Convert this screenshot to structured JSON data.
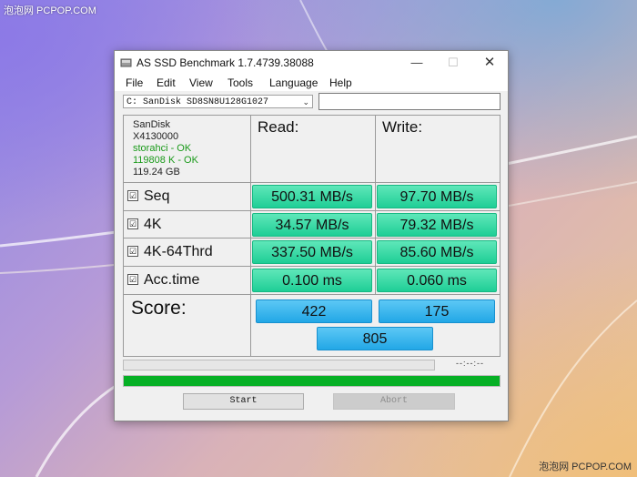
{
  "watermark": {
    "top_left": "泡泡网 PCPOP.COM",
    "bottom_right": "泡泡网 PCPOP.COM"
  },
  "window": {
    "title": "AS SSD Benchmark 1.7.4739.38088",
    "icon": "drive-icon",
    "controls": {
      "minimize": "—",
      "maximize": "☐",
      "close": "✕"
    }
  },
  "menu": [
    "File",
    "Edit",
    "View",
    "Tools",
    "Language",
    "Help"
  ],
  "drive": {
    "selected": "C: SanDisk SD8SN8U128G1027",
    "arrow": "⌄",
    "aux_value": ""
  },
  "device": {
    "name": "SanDisk",
    "firmware": "X4130000",
    "driver": "storahci - OK",
    "alignment": "119808 K - OK",
    "size": "119.24 GB"
  },
  "headers": {
    "read": "Read:",
    "write": "Write:"
  },
  "rows": [
    {
      "label": "Seq",
      "checked": "☑",
      "read": "500.31 MB/s",
      "write": "97.70 MB/s"
    },
    {
      "label": "4K",
      "checked": "☑",
      "read": "34.57 MB/s",
      "write": "79.32 MB/s"
    },
    {
      "label": "4K-64Thrd",
      "checked": "☑",
      "read": "337.50 MB/s",
      "write": "85.60 MB/s"
    },
    {
      "label": "Acc.time",
      "checked": "☑",
      "read": "0.100 ms",
      "write": "0.060 ms"
    }
  ],
  "score": {
    "label": "Score:",
    "read": "422",
    "write": "175",
    "total": "805"
  },
  "status": {
    "time": "--:--:--",
    "progress_main": 1.0,
    "progress_secondary": 0.0
  },
  "buttons": {
    "start": "Start",
    "abort": "Abort"
  },
  "colors": {
    "result_green": "#2bd59f",
    "score_blue": "#2eb0ec",
    "progress_green": "#06b025",
    "device_ok_green": "#1a9a1a"
  }
}
